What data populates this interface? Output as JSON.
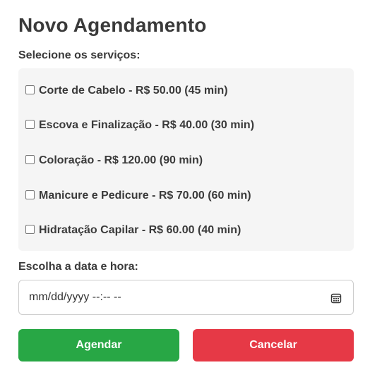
{
  "modal": {
    "title": "Novo Agendamento",
    "services_label": "Selecione os serviços:",
    "services": [
      {
        "label": "Corte de Cabelo - R$ 50.00 (45 min)",
        "checked": false
      },
      {
        "label": "Escova e Finalização - R$ 40.00 (30 min)",
        "checked": false
      },
      {
        "label": "Coloração - R$ 120.00 (90 min)",
        "checked": false
      },
      {
        "label": "Manicure e Pedicure - R$ 70.00 (60 min)",
        "checked": false
      },
      {
        "label": "Hidratação Capilar - R$ 60.00 (40 min)",
        "checked": false
      }
    ],
    "date_label": "Escolha a data e hora:",
    "date_input": {
      "placeholder": "mm/dd/yyyy --:-- --",
      "icon": "calendar-icon"
    },
    "buttons": {
      "confirm_label": "Agendar",
      "cancel_label": "Cancelar"
    }
  },
  "colors": {
    "primary": "#28a745",
    "danger": "#e63946",
    "panel_bg": "#f5f5f5",
    "text": "#3a3a3a"
  }
}
